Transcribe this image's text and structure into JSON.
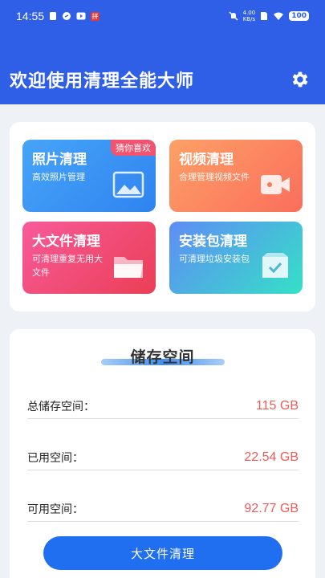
{
  "status_bar": {
    "time": "14:55",
    "net_speed_value": "4.00",
    "net_speed_unit": "KB/s",
    "battery": "100"
  },
  "header": {
    "title": "欢迎使用清理全能大师"
  },
  "tiles": [
    {
      "title": "照片清理",
      "desc": "高效照片管理",
      "tag": "猜你喜欢",
      "icon": "image-icon"
    },
    {
      "title": "视频清理",
      "desc": "合理管理视频文件",
      "icon": "video-camera-icon"
    },
    {
      "title": "大文件清理",
      "desc": "可清理重复无用大文件",
      "icon": "folder-icon"
    },
    {
      "title": "安装包清理",
      "desc": "可清理垃圾安装包",
      "icon": "package-icon"
    }
  ],
  "storage": {
    "title": "储存空间",
    "rows": [
      {
        "label": "总储存空间：",
        "value": "115 GB"
      },
      {
        "label": "已用空间：",
        "value": "22.54 GB"
      },
      {
        "label": "可用空间：",
        "value": "92.77 GB"
      }
    ],
    "button_label": "大文件清理"
  },
  "colors": {
    "header_bg": "#2f5fe6",
    "value_red": "#f05a5a",
    "button_blue": "#1f6ff0"
  }
}
